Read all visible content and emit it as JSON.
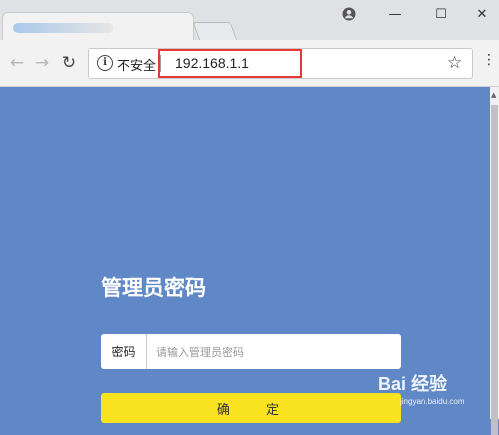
{
  "browser": {
    "address": "192.168.1.1",
    "security_label": "不安全",
    "window_controls": {
      "minimize": "—",
      "maximize": "☐",
      "close": "✕"
    }
  },
  "icons": [
    "profile-icon",
    "minimize-icon",
    "maximize-icon",
    "close-icon",
    "back-icon",
    "forward-icon",
    "reload-icon",
    "info-icon",
    "star-icon",
    "menu-icon"
  ],
  "login": {
    "title": "管理员密码",
    "field_label": "密码",
    "placeholder": "请输入管理员密码",
    "confirm_label": "确 定"
  },
  "watermark": {
    "main": "Bai 经验",
    "sub": "jingyan.baidu.com"
  },
  "colors": {
    "page_bg": "#6188c6",
    "button_bg": "#f9e21f",
    "highlight": "#e53935"
  }
}
